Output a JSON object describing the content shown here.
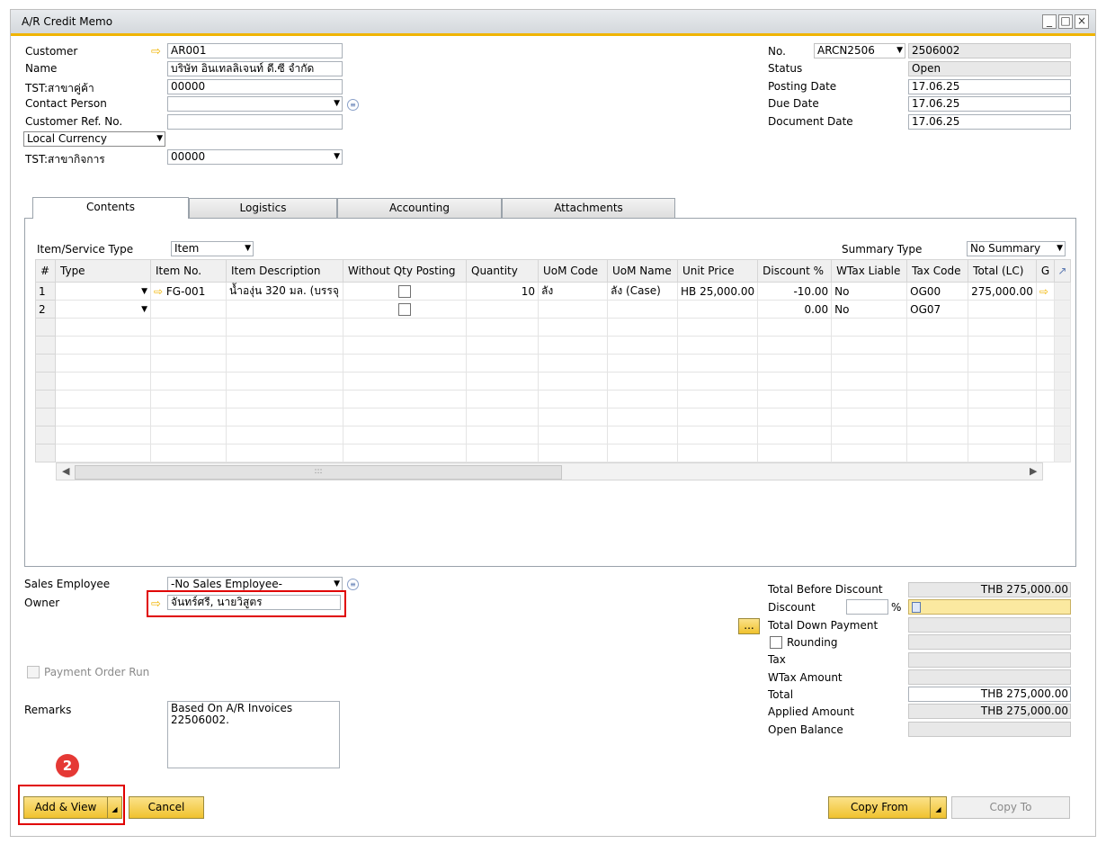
{
  "window": {
    "title": "A/R Credit Memo"
  },
  "header_left": {
    "customer_label": "Customer",
    "customer_value": "AR001",
    "name_label": "Name",
    "name_value": "บริษัท อินเทลลิเจนท์ ดี.ซี จำกัด",
    "branch_label": "TST:สาขาคู่ค้า",
    "branch_value": "00000",
    "contact_label": "Contact Person",
    "contact_value": "",
    "ref_label": "Customer Ref. No.",
    "ref_value": "",
    "currency_value": "Local Currency",
    "biz_branch_label": "TST:สาขากิจการ",
    "biz_branch_value": "00000"
  },
  "header_right": {
    "no_label": "No.",
    "series_value": "ARCN2506",
    "no_value": "2506002",
    "status_label": "Status",
    "status_value": "Open",
    "posting_label": "Posting Date",
    "posting_value": "17.06.25",
    "due_label": "Due Date",
    "due_value": "17.06.25",
    "doc_label": "Document Date",
    "doc_value": "17.06.25"
  },
  "tabs": [
    "Contents",
    "Logistics",
    "Accounting",
    "Attachments"
  ],
  "contents": {
    "item_type_label": "Item/Service Type",
    "item_type_value": "Item",
    "summary_label": "Summary Type",
    "summary_value": "No Summary",
    "columns": [
      "#",
      "Type",
      "Item No.",
      "Item Description",
      "Without Qty Posting",
      "Quantity",
      "UoM Code",
      "UoM Name",
      "Unit Price",
      "Discount %",
      "WTax Liable",
      "Tax Code",
      "Total (LC)",
      "G"
    ],
    "rows": [
      {
        "num": "1",
        "item_no": "FG-001",
        "desc": "น้ำองุ่น 320 มล. (บรรจุ",
        "qty": "10",
        "uom_code": "ลัง",
        "uom_name": "ลัง (Case)",
        "unit_price": "HB 25,000.00",
        "discount": "-10.00",
        "wtax": "No",
        "tax_code": "OG00",
        "total": "275,000.00"
      },
      {
        "num": "2",
        "item_no": "",
        "desc": "",
        "qty": "",
        "uom_code": "",
        "uom_name": "",
        "unit_price": "",
        "discount": "0.00",
        "wtax": "No",
        "tax_code": "OG07",
        "total": ""
      }
    ],
    "scroll_grip": ":::"
  },
  "footer_left": {
    "sales_emp_label": "Sales Employee",
    "sales_emp_value": "-No Sales Employee-",
    "owner_label": "Owner",
    "owner_value": "จันทร์ศรี, นายวิสูตร",
    "payment_order_label": "Payment Order Run",
    "remarks_label": "Remarks",
    "remarks_value": "Based On A/R Invoices 22506002."
  },
  "totals": {
    "before_discount_label": "Total Before Discount",
    "before_discount_value": "THB 275,000.00",
    "discount_label": "Discount",
    "discount_pct_symbol": "%",
    "down_payment_label": "Total Down Payment",
    "rounding_label": "Rounding",
    "tax_label": "Tax",
    "wtax_label": "WTax Amount",
    "total_label": "Total",
    "total_value": "THB 275,000.00",
    "applied_label": "Applied Amount",
    "applied_value": "THB 275,000.00",
    "open_balance_label": "Open Balance",
    "ellipsis": "..."
  },
  "buttons": {
    "add_view": "Add & View",
    "cancel": "Cancel",
    "copy_from": "Copy From",
    "copy_to": "Copy To"
  },
  "annotation": {
    "step": "2"
  }
}
